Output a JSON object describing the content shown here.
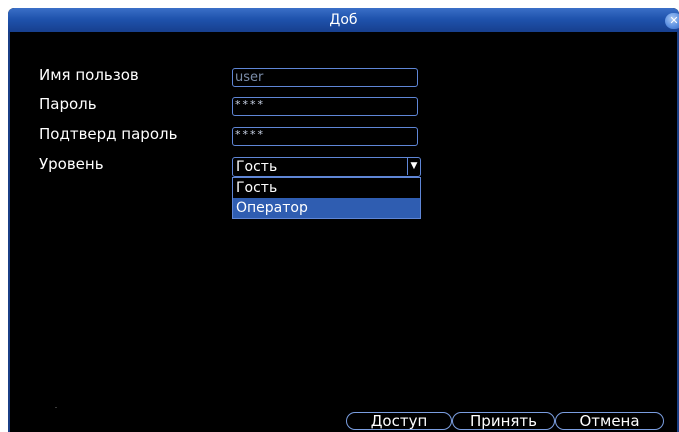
{
  "dialog": {
    "title": "Доб",
    "close_icon": "close-icon"
  },
  "form": {
    "username_label": "Имя пользов",
    "username_value": "user",
    "password_label": "Пароль",
    "password_value": "****",
    "confirm_label": "Подтверд пароль",
    "confirm_value": "****",
    "level_label": "Уровень",
    "level_value": "Гость",
    "level_options": [
      "Гость",
      "Оператор"
    ],
    "level_highlighted": "Оператор"
  },
  "buttons": {
    "access": "Доступ",
    "accept": "Принять",
    "cancel": "Отмена"
  },
  "colors": {
    "title_bar": "#1f53ad",
    "field_border": "#5f86d6",
    "highlight": "#2f5db1",
    "background": "#000000"
  }
}
